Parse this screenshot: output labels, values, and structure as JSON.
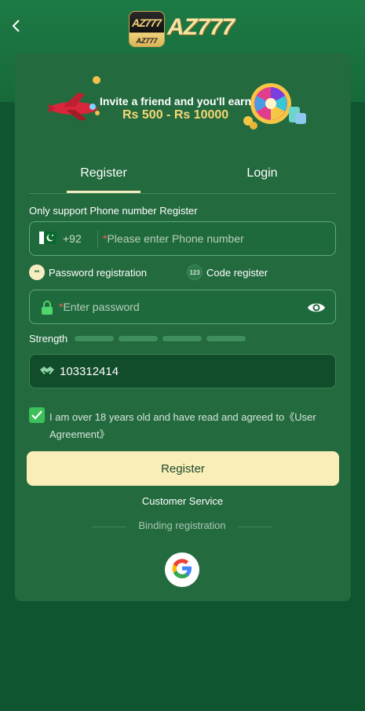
{
  "header": {
    "back_icon": "chevron-left-icon",
    "logo_small_top": "AZ777",
    "logo_small_bottom": "AZ777",
    "logo_text": "AZ777"
  },
  "banner": {
    "title": "Invite a friend and you'll earn",
    "amount": "Rs 500 - Rs 10000"
  },
  "tabs": [
    {
      "label": "Register",
      "active": true
    },
    {
      "label": "Login",
      "active": false
    }
  ],
  "form": {
    "support_label": "Only support Phone number Register",
    "country_code": "+92",
    "phone_placeholder": "Please enter Phone number",
    "required_mark": "*",
    "option_password": "Password registration",
    "option_code": "Code register",
    "option_code_icon_text": "123",
    "password_placeholder": "Enter password",
    "strength_label": "Strength",
    "invite_code": "103312414",
    "agree_text": "I am over 18 years old and have read and agreed to《User Agreement》",
    "agree_checked": true
  },
  "actions": {
    "register_button": "Register",
    "customer_service": "Customer Service",
    "binding_registration": "Binding registration"
  },
  "colors": {
    "background": "#0f5530",
    "card": "#236a3f",
    "button": "#f9eeb8",
    "accent_green": "#3cc15a"
  }
}
